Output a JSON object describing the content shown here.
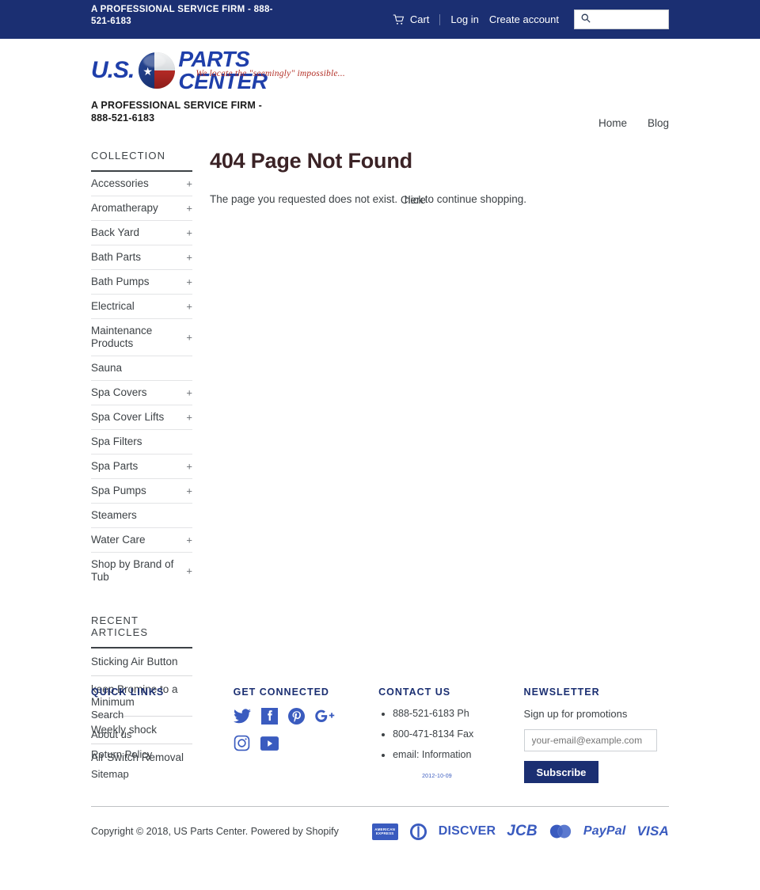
{
  "topbar": {
    "announcement": "A PROFESSIONAL SERVICE FIRM - 888-521-6183",
    "cart_label": "Cart",
    "login_label": "Log in",
    "create_account_label": "Create account",
    "search_placeholder": "",
    "search_value": "",
    "bg_color": "#1b2f72"
  },
  "header": {
    "logo_primary": "U.S.",
    "logo_secondary": "PARTS CENTER",
    "logo_tagline": "We locate the \"seemingly\" impossible...",
    "logo_subtitle": "A PROFESSIONAL SERVICE FIRM - 888-521-6183",
    "nav": [
      {
        "label": "Home"
      },
      {
        "label": "Blog"
      }
    ]
  },
  "sidebar": {
    "collection_title": "Collection",
    "collection_items": [
      {
        "label": "Accessories",
        "expandable": true
      },
      {
        "label": "Aromatherapy",
        "expandable": true
      },
      {
        "label": "Back Yard",
        "expandable": true
      },
      {
        "label": "Bath Parts",
        "expandable": true
      },
      {
        "label": "Bath Pumps",
        "expandable": true
      },
      {
        "label": "Electrical",
        "expandable": true
      },
      {
        "label": "Maintenance Products",
        "expandable": true
      },
      {
        "label": "Sauna",
        "expandable": false
      },
      {
        "label": "Spa Covers",
        "expandable": true
      },
      {
        "label": "Spa Cover Lifts",
        "expandable": true
      },
      {
        "label": "Spa Filters",
        "expandable": false
      },
      {
        "label": "Spa Parts",
        "expandable": true
      },
      {
        "label": "Spa Pumps",
        "expandable": true
      },
      {
        "label": "Steamers",
        "expandable": false
      },
      {
        "label": "Water Care",
        "expandable": true
      },
      {
        "label": "Shop by Brand of Tub",
        "expandable": true
      }
    ],
    "expand_symbol": "+",
    "articles_title": "Recent Articles",
    "articles": [
      {
        "label": "Sticking Air Button"
      },
      {
        "label": "keep Bromine to a Minimum"
      },
      {
        "label": "Weekly shock"
      },
      {
        "label": "Air Switch Removal"
      }
    ]
  },
  "main": {
    "title": "404 Page Not Found",
    "body_before": "The page you requested does not exist. ",
    "link_text": "Click",
    "link_text_overlap": "here",
    "body_after": " to continue shopping."
  },
  "footer": {
    "quick_links_title": "Quick Links",
    "quick_links": [
      {
        "label": "Search"
      },
      {
        "label": "About us"
      },
      {
        "label": "Return Policy"
      },
      {
        "label": "Sitemap"
      }
    ],
    "connected_title": "Get Connected",
    "social": [
      {
        "name": "twitter-icon"
      },
      {
        "name": "facebook-icon"
      },
      {
        "name": "pinterest-icon"
      },
      {
        "name": "googleplus-icon"
      },
      {
        "name": "instagram-icon"
      },
      {
        "name": "youtube-icon"
      }
    ],
    "contact_title": "Contact Us",
    "contact_items": [
      {
        "label": "888-521-6183 Ph"
      },
      {
        "label": "800-471-8134 Fax"
      },
      {
        "label": "email: Information"
      }
    ],
    "stamp_date": "2012-10-09",
    "newsletter_title": "Newsletter",
    "newsletter_text": "Sign up for promotions",
    "newsletter_placeholder": "your-email@example.com",
    "newsletter_value": "",
    "subscribe_label": "Subscribe",
    "copyright": "Copyright © 2018, US Parts Center.",
    "powered_by": "Powered by Shopify",
    "payments": [
      {
        "name": "american-express",
        "label": "AMERICAN EXPRESS"
      },
      {
        "name": "diners-club",
        "label": ""
      },
      {
        "name": "discover",
        "label": "DISCVER"
      },
      {
        "name": "jcb",
        "label": "JCB"
      },
      {
        "name": "mastercard",
        "label": ""
      },
      {
        "name": "paypal",
        "label": "PayPal"
      },
      {
        "name": "visa",
        "label": "VISA"
      }
    ]
  },
  "colors": {
    "brand_blue": "#1b2f72",
    "logo_blue": "#1f3faa",
    "accent_red": "#b33027",
    "payment_blue": "#3a5bbf",
    "text": "#3d4246"
  }
}
